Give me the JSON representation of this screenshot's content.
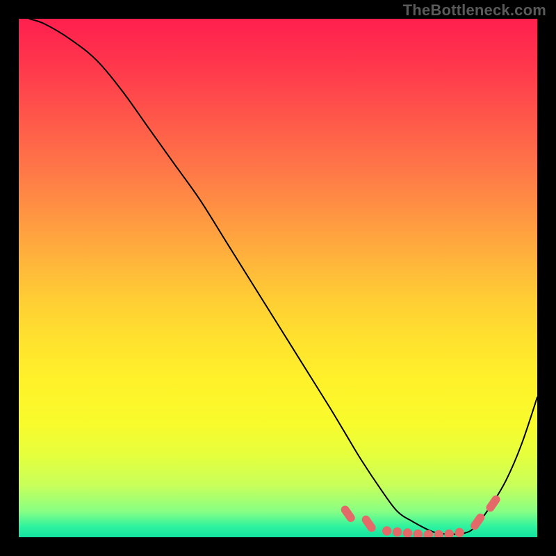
{
  "attribution": "TheBottleneck.com",
  "chart_data": {
    "type": "line",
    "title": "",
    "xlabel": "",
    "ylabel": "",
    "xlim": [
      0,
      100
    ],
    "ylim": [
      0,
      100
    ],
    "series": [
      {
        "name": "curve",
        "x": [
          2,
          5,
          10,
          15,
          20,
          25,
          30,
          35,
          40,
          45,
          50,
          55,
          60,
          63,
          66,
          70,
          73,
          76,
          80,
          83,
          86,
          88,
          91,
          94,
          97,
          100
        ],
        "y": [
          100,
          99,
          96,
          92,
          86,
          79,
          72,
          65,
          57,
          49,
          41,
          33,
          25,
          20,
          15,
          9,
          5,
          3,
          1,
          0.6,
          0.8,
          2,
          6,
          11,
          18,
          27
        ]
      }
    ],
    "markers": {
      "name": "valley-markers",
      "color": "#e46a6a",
      "points": [
        {
          "x": 63.5,
          "y": 4.5,
          "shape": "pill-right",
          "w": 3.5,
          "h": 1.6
        },
        {
          "x": 67.5,
          "y": 2.6,
          "shape": "pill-right",
          "w": 3.5,
          "h": 1.6
        },
        {
          "x": 71.0,
          "y": 1.2,
          "shape": "dot",
          "r": 0.9
        },
        {
          "x": 73.0,
          "y": 1.0,
          "shape": "dot",
          "r": 0.9
        },
        {
          "x": 75.0,
          "y": 0.8,
          "shape": "dot",
          "r": 0.9
        },
        {
          "x": 77.0,
          "y": 0.6,
          "shape": "dot",
          "r": 0.9
        },
        {
          "x": 79.0,
          "y": 0.5,
          "shape": "dot",
          "r": 0.9
        },
        {
          "x": 81.0,
          "y": 0.5,
          "shape": "dot",
          "r": 0.9
        },
        {
          "x": 83.0,
          "y": 0.6,
          "shape": "dot",
          "r": 0.9
        },
        {
          "x": 85.0,
          "y": 0.9,
          "shape": "dot",
          "r": 0.9
        },
        {
          "x": 88.5,
          "y": 3.0,
          "shape": "pill-left",
          "w": 3.5,
          "h": 1.6
        },
        {
          "x": 91.5,
          "y": 6.5,
          "shape": "pill-left",
          "w": 3.5,
          "h": 1.6
        }
      ]
    }
  }
}
